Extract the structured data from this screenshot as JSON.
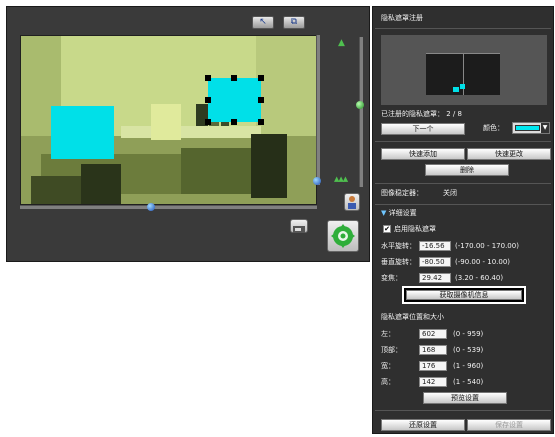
{
  "toolbar": {
    "select_icon": "↖",
    "fit_icon": "⧉"
  },
  "mask_list": {
    "title": "隐私遮罩注册",
    "registered_label": "已注册的隐私遮罩：",
    "registered_count": "2 / 8",
    "next_button": "下一个",
    "color_label": "颜色：",
    "color_value": "#00e8f0",
    "quick_add_button": "快速添加",
    "quick_update_button": "快速更改",
    "delete_button": "删除"
  },
  "image_mode": {
    "label": "图像稳定器：",
    "value": "关闭"
  },
  "details": {
    "header": "详细设置",
    "enable_label": "启用隐私遮罩",
    "enable_checked": true,
    "pan_label": "水平旋转：",
    "pan_value": "-16.56",
    "pan_range": "(-170.00 - 170.00)",
    "tilt_label": "垂直旋转：",
    "tilt_value": "-80.50",
    "tilt_range": "(-90.00 - 10.00)",
    "zoom_label": "变焦：",
    "zoom_value": "29.42",
    "zoom_range": "(3.20 - 60.40)",
    "get_camera_info_button": "获取摄像机信息"
  },
  "position": {
    "title": "隐私遮罩位置和大小",
    "left_label": "左：",
    "left_value": "602",
    "left_range": "(0 - 959)",
    "top_label": "顶部：",
    "top_value": "168",
    "top_range": "(0 - 539)",
    "width_label": "宽：",
    "width_value": "176",
    "width_range": "(1 - 960)",
    "height_label": "高：",
    "height_value": "142",
    "height_range": "(1 - 540)",
    "apply_button": "预览设置"
  },
  "footer": {
    "restore_button": "还原设置",
    "save_button": "保存设置"
  },
  "colors": {
    "mask": "#00e0e8",
    "scene": "#c7d886",
    "panel": "#2f2f2f"
  }
}
